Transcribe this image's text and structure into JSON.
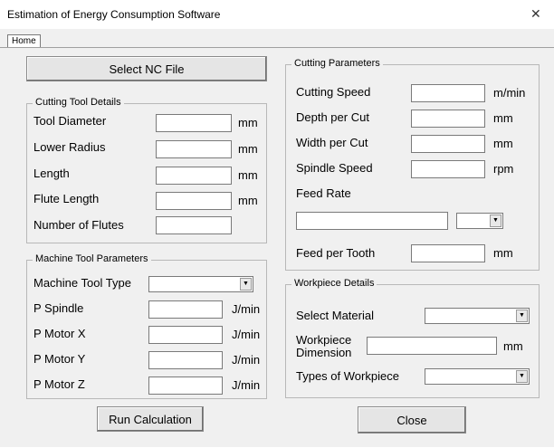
{
  "window": {
    "title": "Estimation of Energy Consumption Software",
    "close_glyph": "✕"
  },
  "tabs": [
    {
      "label": "Home"
    }
  ],
  "buttons": {
    "select_nc": "Select NC File",
    "run": "Run Calculation",
    "close": "Close"
  },
  "cutting_tool": {
    "title": "Cutting Tool Details",
    "fields": [
      {
        "label": "Tool Diameter",
        "unit": "mm",
        "value": ""
      },
      {
        "label": "Lower Radius",
        "unit": "mm",
        "value": ""
      },
      {
        "label": "Length",
        "unit": "mm",
        "value": ""
      },
      {
        "label": "Flute Length",
        "unit": "mm",
        "value": ""
      },
      {
        "label": "Number of Flutes",
        "unit": "",
        "value": ""
      }
    ]
  },
  "machine_tool": {
    "title": "Machine Tool Parameters",
    "type_label": "Machine Tool Type",
    "type_value": "",
    "fields": [
      {
        "label": "P Spindle",
        "unit": "J/min",
        "value": ""
      },
      {
        "label": "P Motor X",
        "unit": "J/min",
        "value": ""
      },
      {
        "label": "P Motor Y",
        "unit": "J/min",
        "value": ""
      },
      {
        "label": "P Motor Z",
        "unit": "J/min",
        "value": ""
      }
    ]
  },
  "cutting_params": {
    "title": "Cutting Parameters",
    "fields": [
      {
        "label": "Cutting Speed",
        "unit": "m/min",
        "value": ""
      },
      {
        "label": "Depth per Cut",
        "unit": "mm",
        "value": ""
      },
      {
        "label": "Width per Cut",
        "unit": "mm",
        "value": ""
      },
      {
        "label": "Spindle Speed",
        "unit": "rpm",
        "value": ""
      }
    ],
    "feed_rate_label": "Feed Rate",
    "feed_rate_value": "",
    "feed_rate_unit_value": "",
    "feed_per_tooth_label": "Feed per Tooth",
    "feed_per_tooth_unit": "mm",
    "feed_per_tooth_value": ""
  },
  "workpiece": {
    "title": "Workpiece Details",
    "material_label": "Select Material",
    "material_value": "",
    "dimension_label_1": "Workpiece",
    "dimension_label_2": "Dimension",
    "dimension_unit": "mm",
    "dimension_value": "",
    "type_label": "Types of Workpiece",
    "type_value": ""
  },
  "colors": {
    "window_bg": "#f0f0f0",
    "titlebar_bg": "#ffffff",
    "button_bg": "#e5e5e5",
    "field_bg": "#ffffff"
  },
  "icons": {
    "dropdown": "dropdown-arrow-icon",
    "close": "close-icon"
  }
}
